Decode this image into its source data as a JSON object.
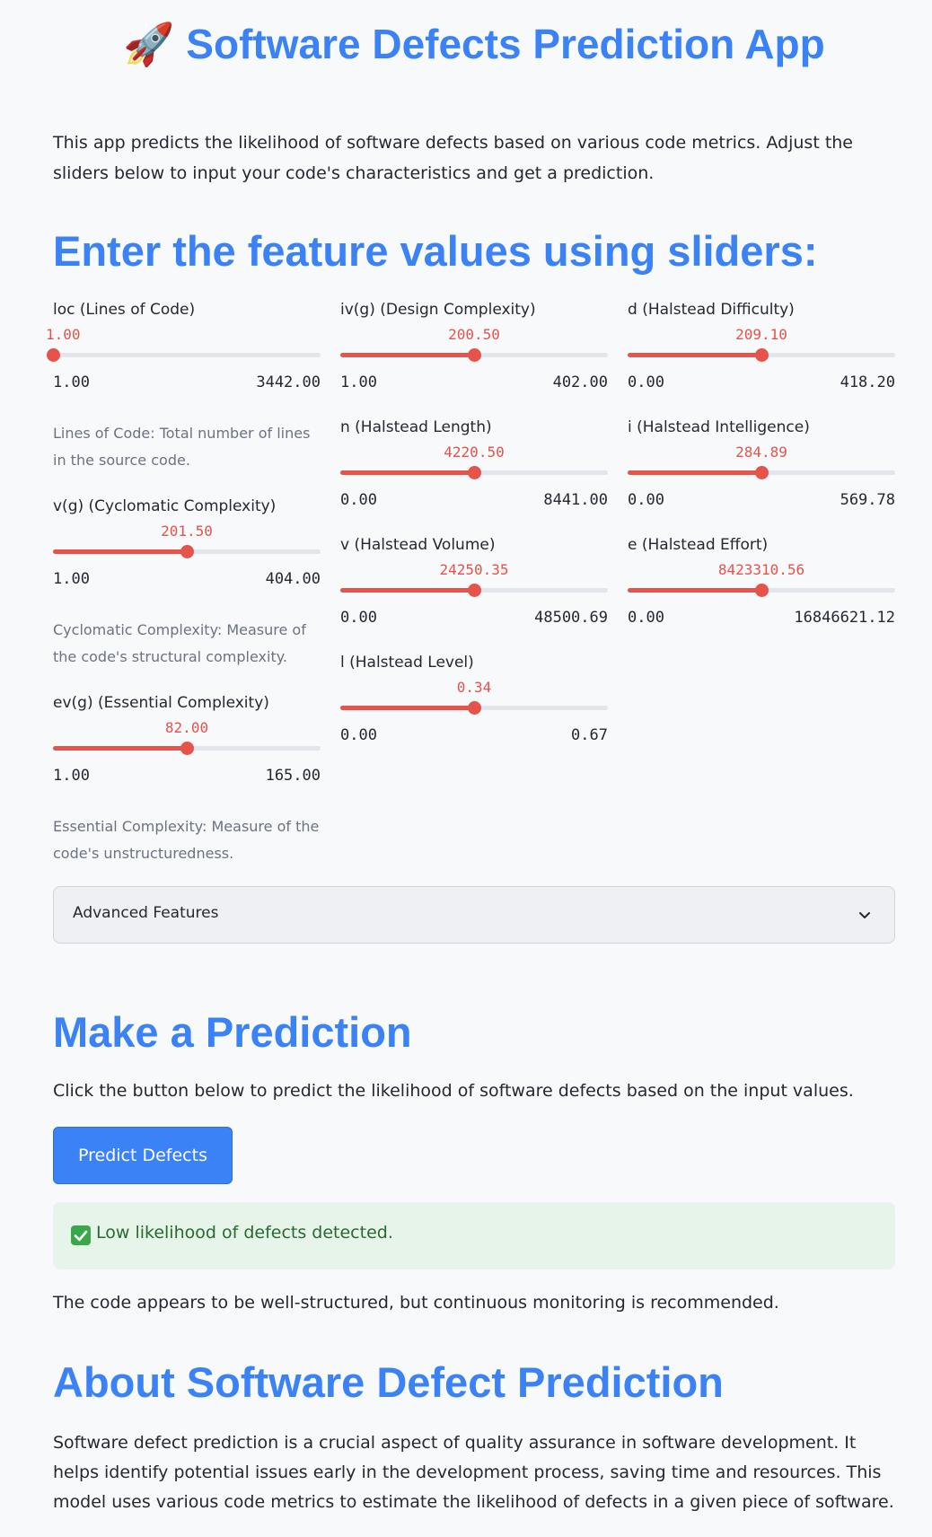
{
  "header": {
    "title": "🚀 Software Defects Prediction App"
  },
  "intro": "This app predicts the likelihood of software defects based on various code metrics. Adjust the sliders below to input your code's characteristics and get a prediction.",
  "features_heading": "Enter the feature values using sliders:",
  "sliders": [
    {
      "label": "loc (Lines of Code)",
      "value": "1.00",
      "min": "1.00",
      "max": "3442.00",
      "fraction": 0.0
    },
    {
      "label": "v(g) (Cyclomatic Complexity)",
      "value": "201.50",
      "min": "1.00",
      "max": "404.00",
      "fraction": 0.5
    },
    {
      "label": "ev(g) (Essential Complexity)",
      "value": "82.00",
      "min": "1.00",
      "max": "165.00",
      "fraction": 0.5
    },
    {
      "label": "iv(g) (Design Complexity)",
      "value": "200.50",
      "min": "1.00",
      "max": "402.00",
      "fraction": 0.5
    },
    {
      "label": "n (Halstead Length)",
      "value": "4220.50",
      "min": "0.00",
      "max": "8441.00",
      "fraction": 0.5
    },
    {
      "label": "v (Halstead Volume)",
      "value": "24250.35",
      "min": "0.00",
      "max": "48500.69",
      "fraction": 0.5
    },
    {
      "label": "l (Halstead Level)",
      "value": "0.34",
      "min": "0.00",
      "max": "0.67",
      "fraction": 0.5
    },
    {
      "label": "d (Halstead Difficulty)",
      "value": "209.10",
      "min": "0.00",
      "max": "418.20",
      "fraction": 0.5
    },
    {
      "label": "i (Halstead Intelligence)",
      "value": "284.89",
      "min": "0.00",
      "max": "569.78",
      "fraction": 0.5
    },
    {
      "label": "e (Halstead Effort)",
      "value": "8423310.56",
      "min": "0.00",
      "max": "16846621.12",
      "fraction": 0.5
    }
  ],
  "captions": {
    "loc": "Lines of Code: Total number of lines in the source code.",
    "vg": "Cyclomatic Complexity: Measure of the code's structural complexity.",
    "evg": "Essential Complexity: Measure of the code's unstructuredness."
  },
  "advanced": {
    "label": "Advanced Features",
    "icon": "chevron-down-icon"
  },
  "prediction": {
    "heading": "Make a Prediction",
    "instruction": "Click the button below to predict the likelihood of software defects based on the input values.",
    "button_label": "Predict Defects",
    "result_icon": "check-icon",
    "result": "Low likelihood of defects detected.",
    "note": "The code appears to be well-structured, but continuous monitoring is recommended."
  },
  "about": {
    "heading": "About Software Defect Prediction",
    "text": "Software defect prediction is a crucial aspect of quality assurance in software development. It helps identify potential issues early in the development process, saving time and resources. This model uses various code metrics to estimate the likelihood of defects in a given piece of software."
  },
  "colors": {
    "accent": "#3b82f6",
    "slider": "#e5534b",
    "success_bg": "#e7f4e9",
    "success_text": "#256b30"
  }
}
